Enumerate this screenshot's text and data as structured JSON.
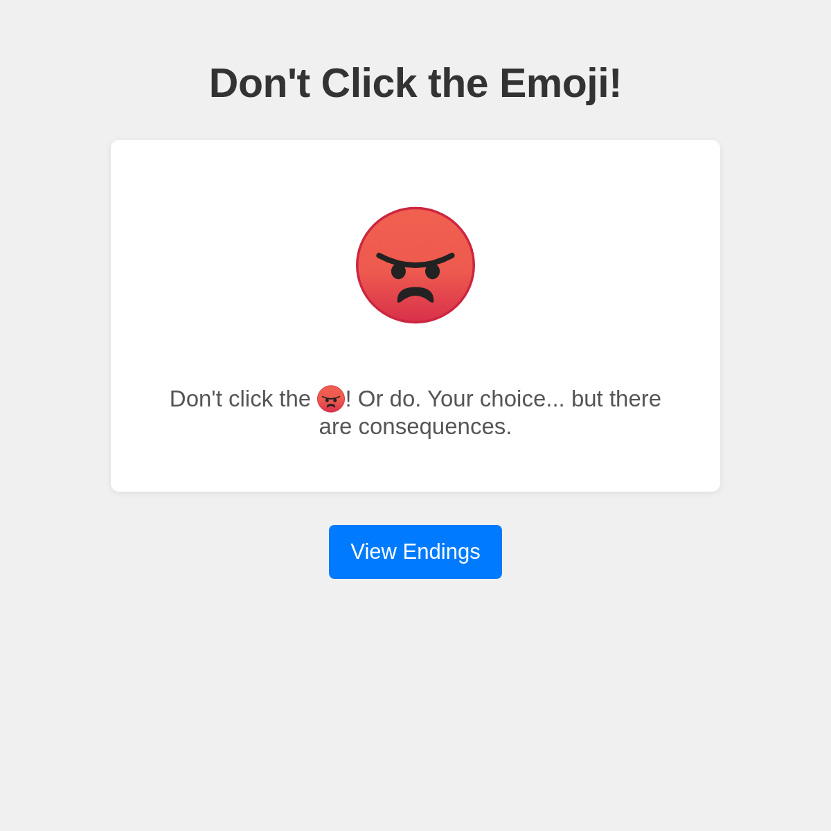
{
  "title": "Don't Click the Emoji!",
  "message": {
    "before": "Don't click the",
    "after": "! Or do. Your choice... but there are consequences."
  },
  "button": {
    "label": "View Endings"
  }
}
